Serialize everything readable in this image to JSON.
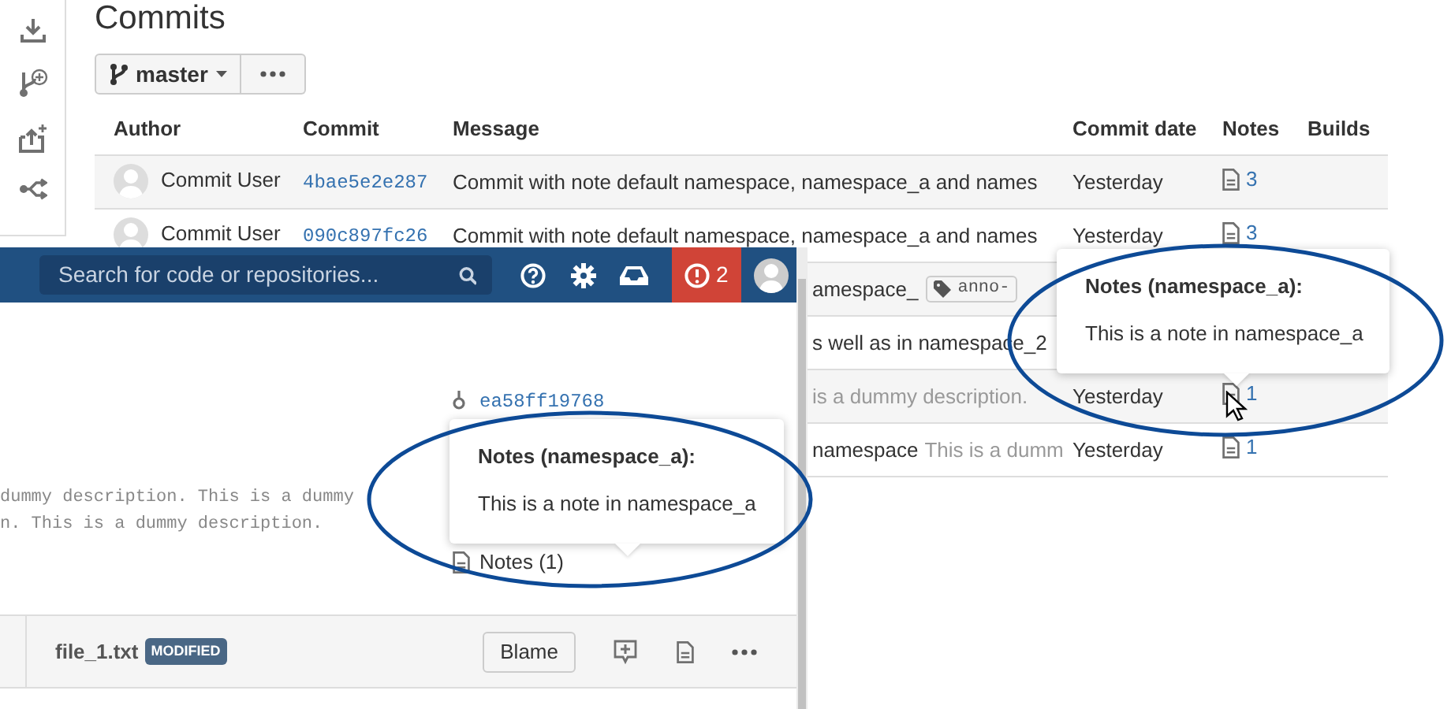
{
  "commits_page": {
    "title": "Commits",
    "branch": "master",
    "columns": [
      "Author",
      "Commit",
      "Message",
      "Commit date",
      "Notes",
      "Builds"
    ],
    "rows": [
      {
        "author": "Commit User",
        "commit": "4bae5e2e287",
        "message": [
          {
            "kind": "title",
            "text": "Commit with note default namespace, namespace_a and names"
          }
        ],
        "date": "Yesterday",
        "notes": "3",
        "hovered": false
      },
      {
        "author": "Commit User",
        "commit": "090c897fc26",
        "message": [
          {
            "kind": "title",
            "text": "Commit with note default namespace, namespace_a and names"
          }
        ],
        "date": "Yesterday",
        "notes": "3",
        "hovered": false
      },
      {
        "message": [
          {
            "kind": "title",
            "text": "amespace_"
          },
          {
            "kind": "tag",
            "text": "anno-"
          }
        ],
        "hovered": false
      },
      {
        "message": [
          {
            "kind": "title",
            "text": "s well as in namespace_2"
          }
        ],
        "hovered": false
      },
      {
        "message": [
          {
            "kind": "description",
            "text": "is a dummy description."
          }
        ],
        "date": "Yesterday",
        "notes": "1",
        "hovered": true
      },
      {
        "message": [
          {
            "kind": "title",
            "text": "namespace"
          },
          {
            "kind": "description",
            "text": "This is a dumm"
          }
        ],
        "date": "Yesterday",
        "notes": "1",
        "hovered": false
      }
    ],
    "popover": {
      "title": "Notes (namespace_a):",
      "body": "This is a note in namespace_a"
    }
  },
  "commit_window": {
    "search": {
      "placeholder": "Search for code or repositories..."
    },
    "alert_count": "2",
    "commit_hash": "ea58ff19768",
    "description": [
      "dummy description. This is a dummy",
      "n. This is a dummy description."
    ],
    "popover": {
      "title": "Notes (namespace_a):",
      "body": "This is a note in namespace_a"
    },
    "notes_link": "Notes (1)",
    "file": {
      "name": "file_1.txt",
      "status": "MODIFIED",
      "blame": "Blame"
    }
  }
}
